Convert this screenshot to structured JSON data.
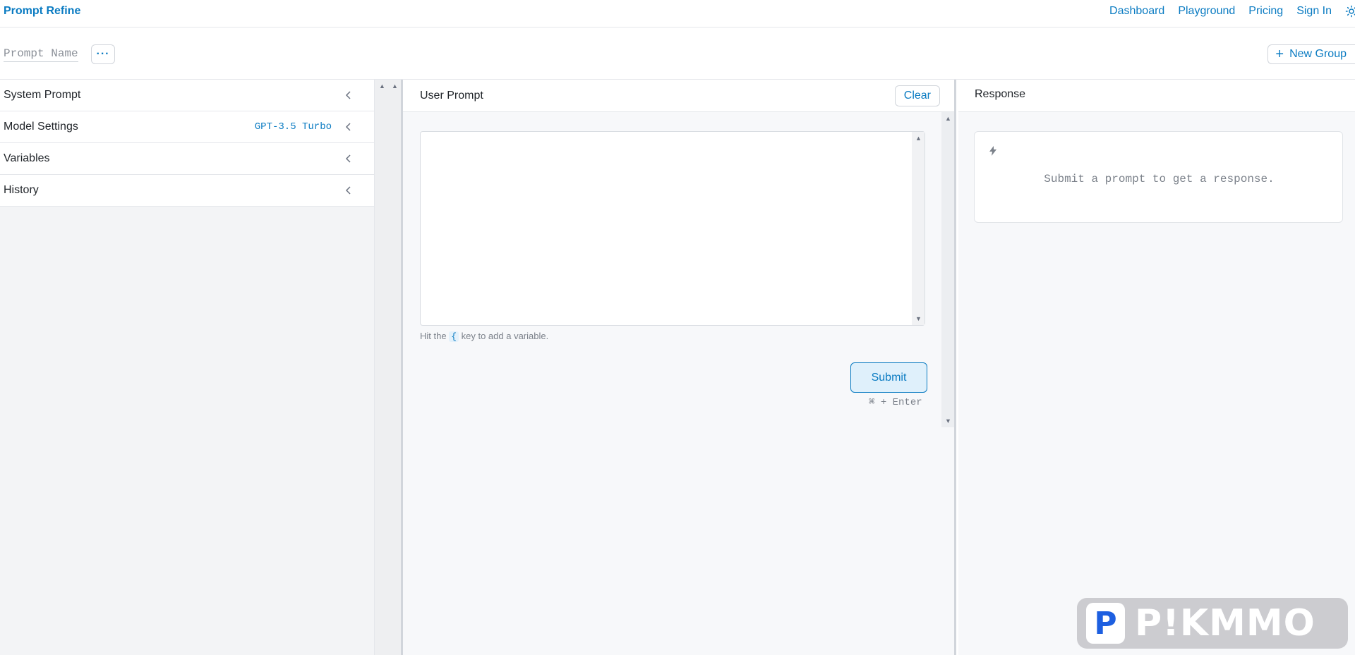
{
  "nav": {
    "brand": "Prompt Refine",
    "links": [
      "Dashboard",
      "Playground",
      "Pricing",
      "Sign In"
    ],
    "theme_icon": "sun-icon"
  },
  "toolbar": {
    "prompt_name_placeholder": "Prompt Name",
    "more_label": "···",
    "new_group_label": "New Group",
    "new_group_icon": "+"
  },
  "sidebar": {
    "items": [
      {
        "label": "System Prompt",
        "value": ""
      },
      {
        "label": "Model Settings",
        "value": "GPT-3.5 Turbo"
      },
      {
        "label": "Variables",
        "value": ""
      },
      {
        "label": "History",
        "value": ""
      }
    ]
  },
  "user_prompt": {
    "title": "User Prompt",
    "clear_label": "Clear",
    "value": "",
    "hint_before": "Hit the",
    "hint_key": "{",
    "hint_after": "key to add a variable.",
    "submit_label": "Submit",
    "shortcut": "⌘ + Enter"
  },
  "response": {
    "title": "Response",
    "icon": "bolt-icon",
    "empty_text": "Submit a prompt to get a response."
  },
  "watermark": {
    "logo_letter": "P",
    "text": "P!KMMO"
  },
  "colors": {
    "accent": "#0a7bc2",
    "panel_bg": "#f3f4f6",
    "submit_bg": "#dff0fb"
  }
}
